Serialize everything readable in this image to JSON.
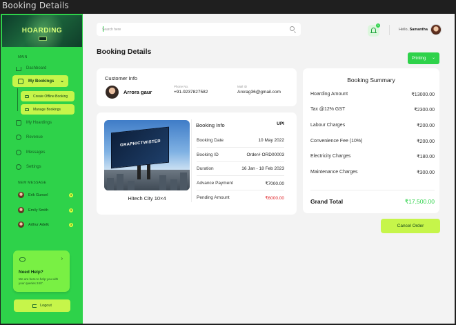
{
  "window": {
    "title": "Booking Details"
  },
  "brand": {
    "name": "HOARDING",
    "tagline": "",
    "badge": ""
  },
  "sidebar": {
    "main_label": "MAIN",
    "items": [
      {
        "label": "Dashboard"
      },
      {
        "label": "My Bookings"
      },
      {
        "label": "My Hoardings"
      },
      {
        "label": "Revenue"
      },
      {
        "label": "Messages"
      },
      {
        "label": "Settings"
      }
    ],
    "sub_items": [
      {
        "label": "Create Offline Booking"
      },
      {
        "label": "Manage Bookings"
      }
    ],
    "messages_label": "NEW MESSAGE",
    "messages": [
      {
        "name": "Erik Gunsel",
        "count": "3"
      },
      {
        "name": "Emily Smith",
        "count": "3"
      },
      {
        "name": "Arthur Adelk",
        "count": "3"
      }
    ],
    "help": {
      "title": "Need Help?",
      "text": "We are here to help you with your queries 24/7."
    },
    "logout": "Logout"
  },
  "header": {
    "search_placeholder": "Search here",
    "notifications": "1",
    "greeting": "Hello, ",
    "user": "Samantha"
  },
  "page": {
    "title": "Booking Details",
    "print_label": "Printing"
  },
  "customer": {
    "section": "Customer Info",
    "name": "Arrora gaur",
    "phone_label": "Phone No.",
    "phone": "+91-9237827582",
    "mail_label": "Mail ID",
    "mail": "Arorag36@gmail.com"
  },
  "hoarding": {
    "board_text": "GRAPHICTWISTER",
    "caption": "Hitech City 10×4"
  },
  "booking": {
    "section": "Booking Info",
    "method": "UPI",
    "rows": [
      {
        "label": "Booking Date",
        "value": "10 May 2022"
      },
      {
        "label": "Booking ID",
        "value": "Order# ORD00003"
      },
      {
        "label": "Duration",
        "value": "16 Jan - 18 Feb 2023"
      },
      {
        "label": "Advance Payment",
        "value": "₹7000.00"
      },
      {
        "label": "Pending Amount",
        "value": "₹6000.00"
      }
    ]
  },
  "summary": {
    "title": "Booking Summary",
    "rows": [
      {
        "label": "Hoarding Amount",
        "value": "₹13000.00"
      },
      {
        "label": "Tax @12% GST",
        "value": "₹2300.00"
      },
      {
        "label": "Labour Charges",
        "value": "₹200.00"
      },
      {
        "label": "Convenience Fee (10%)",
        "value": "₹200.00"
      },
      {
        "label": "Electricity Charges",
        "value": "₹180.00"
      },
      {
        "label": "Maintenance Charges",
        "value": "₹300.00"
      }
    ],
    "total_label": "Grand Total",
    "total_value": "₹17,500.00"
  },
  "actions": {
    "cancel": "Cancel Order"
  },
  "colors": {
    "accent": "#2ed24a",
    "lime": "#c6f54a",
    "pending": "#e0262b"
  }
}
